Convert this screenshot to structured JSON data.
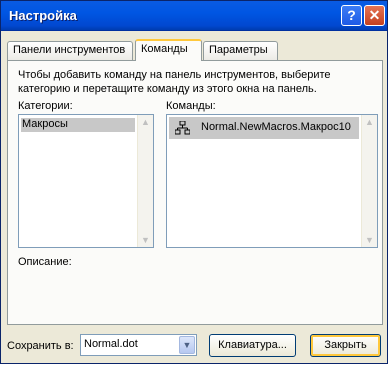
{
  "window": {
    "title": "Настройка",
    "help_glyph": "?",
    "close_glyph": "✕"
  },
  "tabs": [
    {
      "label": "Панели инструментов",
      "active": false
    },
    {
      "label": "Команды",
      "active": true
    },
    {
      "label": "Параметры",
      "active": false
    }
  ],
  "commands_tab": {
    "instructions": "Чтобы добавить команду на панель инструментов, выберите категорию и перетащите команду из этого окна на панель.",
    "categories_label": "Категории:",
    "categories": [
      "Макросы"
    ],
    "selected_category": "Макросы",
    "commands_label": "Команды:",
    "commands": [
      {
        "label": "Normal.NewMacros.Макрос10",
        "icon": "macro-icon"
      }
    ],
    "description_label": "Описание:"
  },
  "footer": {
    "save_in_label": "Сохранить в:",
    "save_in_value": "Normal.dot",
    "keyboard_button": "Клавиатура...",
    "close_button": "Закрыть"
  },
  "colors": {
    "title_bar": "#0054e3",
    "dialog_bg": "#ece9d8",
    "selection": "#c8c8c8",
    "tab_highlight": "#ffc83c"
  }
}
